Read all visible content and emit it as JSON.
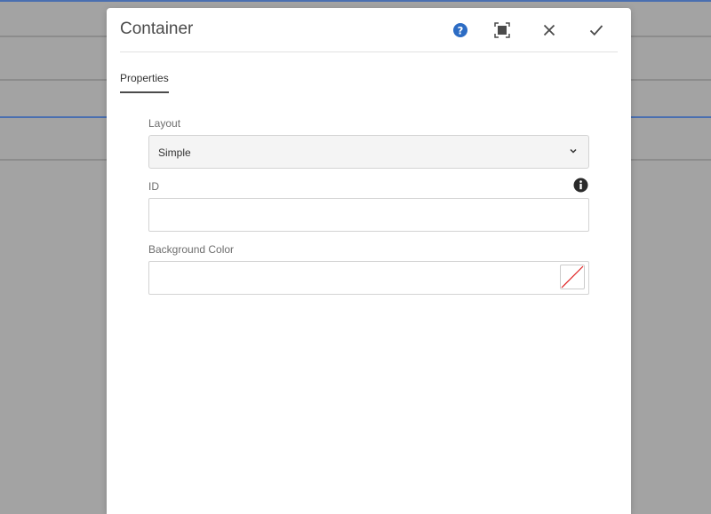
{
  "dialog": {
    "title": "Container",
    "header_icons": {
      "help": "help-icon",
      "fullscreen": "fullscreen-icon",
      "close": "close-icon",
      "done": "checkmark-icon"
    }
  },
  "tabs": [
    {
      "label": "Properties",
      "selected": true
    }
  ],
  "fields": {
    "layout": {
      "label": "Layout",
      "value": "Simple"
    },
    "id": {
      "label": "ID",
      "value": "",
      "info_icon": "info-icon"
    },
    "background_color": {
      "label": "Background Color",
      "value": "",
      "swatch": "none"
    }
  },
  "colors": {
    "accent_blue": "#2c6cc4",
    "backdrop": "#a3a3a3",
    "swatch_none_line": "#e02020"
  }
}
